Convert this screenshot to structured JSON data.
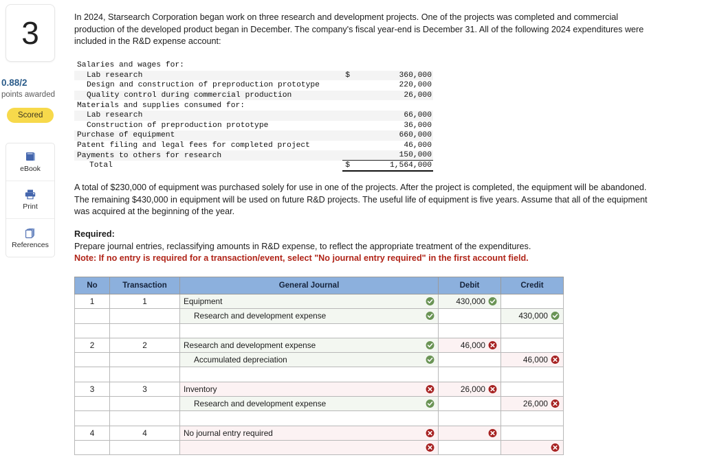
{
  "sidebar": {
    "question_number": "3",
    "points_awarded": "0.88/2",
    "points_label": "points awarded",
    "status_badge": "Scored",
    "tools": [
      {
        "label": "eBook",
        "icon": "book-icon"
      },
      {
        "label": "Print",
        "icon": "printer-icon"
      },
      {
        "label": "References",
        "icon": "copy-icon"
      }
    ],
    "colors": {
      "badge": "#f7d94b",
      "score_text": "#2b5c8a",
      "icon": "#4466ad"
    }
  },
  "main": {
    "intro": "In 2024, Starsearch Corporation began work on three research and development projects. One of the projects was completed and commercial production of the developed product began in December. The company's fiscal year-end is December 31. All of the following 2024 expenditures were included in the R&D expense account:",
    "equipment_note": "A total of $230,000 of equipment was purchased solely for use in one of the projects. After the project is completed, the equipment will be abandoned. The remaining $430,000 in equipment will be used on future R&D projects. The useful life of equipment is five years. Assume that all of the equipment was acquired at the beginning of the year.",
    "required_heading": "Required:",
    "required_text": "Prepare journal entries, reclassifying amounts in R&D expense, to reflect the appropriate treatment of the expenditures.",
    "required_note": "Note: If no entry is required for a transaction/event, select \"No journal entry required\" in the first account field."
  },
  "expenditures": {
    "rows": [
      {
        "label": "Salaries and wages for:",
        "indent": false,
        "currency": "",
        "value": ""
      },
      {
        "label": "Lab research",
        "indent": true,
        "currency": "$",
        "value": "360,000"
      },
      {
        "label": "Design and construction of preproduction prototype",
        "indent": true,
        "currency": "",
        "value": "220,000"
      },
      {
        "label": "Quality control during commercial production",
        "indent": true,
        "currency": "",
        "value": "26,000"
      },
      {
        "label": "Materials and supplies consumed for:",
        "indent": false,
        "currency": "",
        "value": ""
      },
      {
        "label": "Lab research",
        "indent": true,
        "currency": "",
        "value": "66,000"
      },
      {
        "label": "Construction of preproduction prototype",
        "indent": true,
        "currency": "",
        "value": "36,000"
      },
      {
        "label": "Purchase of equipment",
        "indent": false,
        "currency": "",
        "value": "660,000"
      },
      {
        "label": "Patent filing and legal fees for completed project",
        "indent": false,
        "currency": "",
        "value": "46,000"
      },
      {
        "label": "Payments to others for research",
        "indent": false,
        "currency": "",
        "value": "150,000"
      }
    ],
    "total_label": "Total",
    "total_currency": "$",
    "total_value": "1,564,000"
  },
  "journal": {
    "headers": {
      "no": "No",
      "transaction": "Transaction",
      "general_journal": "General Journal",
      "debit": "Debit",
      "credit": "Credit"
    },
    "rows": [
      {
        "no": "1",
        "transaction": "1",
        "account": "Equipment",
        "indent": false,
        "acct_mark": "check",
        "debit": "430,000",
        "debit_mark": "check",
        "credit": "",
        "credit_mark": ""
      },
      {
        "no": "",
        "transaction": "",
        "account": "Research and development expense",
        "indent": true,
        "acct_mark": "check",
        "debit": "",
        "debit_mark": "",
        "credit": "430,000",
        "credit_mark": "check"
      },
      {
        "no": "",
        "transaction": "",
        "account": "",
        "indent": false,
        "acct_mark": "",
        "debit": "",
        "debit_mark": "",
        "credit": "",
        "credit_mark": ""
      },
      {
        "no": "2",
        "transaction": "2",
        "account": "Research and development expense",
        "indent": false,
        "acct_mark": "check",
        "debit": "46,000",
        "debit_mark": "cross",
        "credit": "",
        "credit_mark": ""
      },
      {
        "no": "",
        "transaction": "",
        "account": "Accumulated depreciation",
        "indent": true,
        "acct_mark": "check",
        "debit": "",
        "debit_mark": "",
        "credit": "46,000",
        "credit_mark": "cross"
      },
      {
        "no": "",
        "transaction": "",
        "account": "",
        "indent": false,
        "acct_mark": "",
        "debit": "",
        "debit_mark": "",
        "credit": "",
        "credit_mark": ""
      },
      {
        "no": "3",
        "transaction": "3",
        "account": "Inventory",
        "indent": false,
        "acct_mark": "cross",
        "debit": "26,000",
        "debit_mark": "cross",
        "credit": "",
        "credit_mark": ""
      },
      {
        "no": "",
        "transaction": "",
        "account": "Research and development expense",
        "indent": true,
        "acct_mark": "check",
        "debit": "",
        "debit_mark": "",
        "credit": "26,000",
        "credit_mark": "cross"
      },
      {
        "no": "",
        "transaction": "",
        "account": "",
        "indent": false,
        "acct_mark": "",
        "debit": "",
        "debit_mark": "",
        "credit": "",
        "credit_mark": ""
      },
      {
        "no": "4",
        "transaction": "4",
        "account": "No journal entry required",
        "indent": false,
        "acct_mark": "cross",
        "debit": "",
        "debit_mark": "cross",
        "credit": "",
        "credit_mark": ""
      },
      {
        "no": "",
        "transaction": "",
        "account": "",
        "indent": false,
        "acct_mark": "cross",
        "debit": "",
        "debit_mark": "",
        "credit": "",
        "credit_mark": "cross"
      }
    ],
    "colors": {
      "header_bg": "#8cb0dd",
      "correct": "#6a9455",
      "incorrect": "#a72222"
    }
  }
}
